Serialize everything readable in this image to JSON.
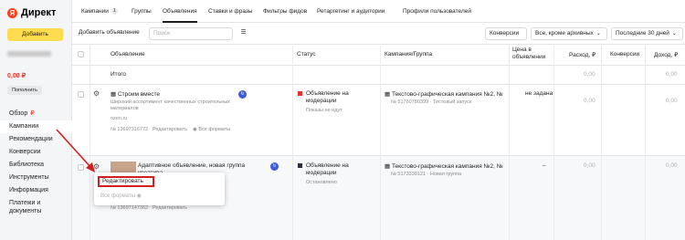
{
  "app": {
    "logo_letter": "Я",
    "logo_text": "Директ"
  },
  "sidebar": {
    "add_button": "Добавить",
    "balance": "0,00 ₽",
    "topup": "Пополнить",
    "nav": [
      {
        "label": "Обзор",
        "badge": "₽"
      },
      {
        "label": "Кампании",
        "badge": ""
      },
      {
        "label": "Рекомендации",
        "badge": ""
      },
      {
        "label": "Конверсии",
        "badge": ""
      },
      {
        "label": "Библиотека",
        "badge": ""
      },
      {
        "label": "Инструменты",
        "badge": ""
      },
      {
        "label": "Информация",
        "badge": ""
      },
      {
        "label": "Платежи и документы",
        "badge": ""
      }
    ]
  },
  "tabs": [
    {
      "label": "Кампании",
      "count": "1"
    },
    {
      "label": "Группы"
    },
    {
      "label": "Объявления"
    },
    {
      "label": "Ставки и фразы"
    },
    {
      "label": "Фильтры фидов"
    },
    {
      "label": "Ретаргетинг и аудитории"
    },
    {
      "label": "Профили пользователей"
    }
  ],
  "toolbar": {
    "add_ad": "Добавить объявление",
    "search_placeholder": "Поиск",
    "conversions": "Конверсии",
    "filter": "Все, кроме архивных",
    "period": "Последние 30 дней"
  },
  "table": {
    "headers": {
      "ad": "Объявление",
      "status": "Статус",
      "campaign": "Кампания/Группа",
      "price": "Цена в объявлении",
      "spend": "Расход, ₽",
      "conversions": "Конверсии",
      "income": "Доход, ₽"
    },
    "total": {
      "label": "Итого",
      "spend": "0,00",
      "income": "0,00"
    },
    "rows": [
      {
        "title": "Строим вместе",
        "desc_1": "Широкий ассортимент качественных строительных",
        "desc_2": "материалов",
        "domain": "ozen.ru",
        "id": "№ 13697316772",
        "edit": "Редактировать",
        "formats": "Все форматы",
        "status_1": "Объявление на",
        "status_2": "модерации",
        "status_sub": "Показы не идут",
        "campaign": "Текстово-графическая кампания №2, №",
        "campaign_sub": "№ 51760780399 · Тестовый запуск",
        "price": "не задана",
        "spend": "0,00",
        "income": "0,00",
        "status_color": "#e0362b"
      },
      {
        "title": "Адаптивное объявление, новая группа",
        "title_2": "креатива",
        "id": "№ 13697147362",
        "edit": "Редактировать",
        "status_1": "Объявление на",
        "status_2": "модерации",
        "status_sub": "Остановлено",
        "campaign": "Текстово-графическая кампания №2, №",
        "campaign_sub": "№ 5173339121 · Новая группа",
        "price": "–",
        "spend": "0,00",
        "income": "0,00",
        "status_color": "#2f3138"
      }
    ]
  },
  "popup": {
    "edit": "Редактировать",
    "formats": "Все форматы"
  }
}
